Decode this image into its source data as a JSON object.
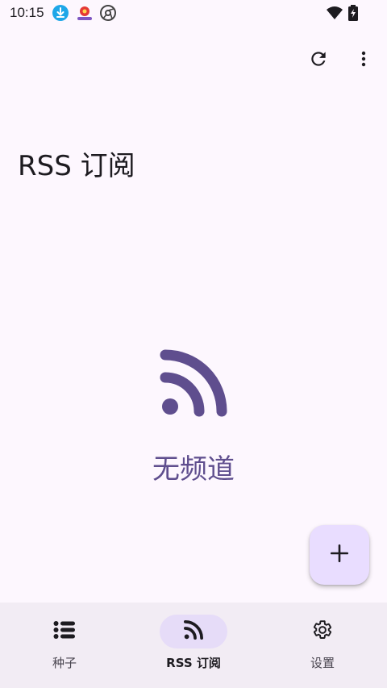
{
  "status_bar": {
    "time": "10:15",
    "icons": [
      "download-icon",
      "app-notification-icon",
      "chrome-like-icon",
      "wifi-icon",
      "battery-charging-icon"
    ]
  },
  "toolbar": {
    "refresh_icon": "refresh-icon",
    "more_icon": "more-vert-icon"
  },
  "page": {
    "title": "RSS 订阅"
  },
  "empty_state": {
    "icon": "rss-feed-icon",
    "message": "无频道"
  },
  "fab": {
    "icon": "add-icon",
    "label": "+"
  },
  "bottom_nav": {
    "items": [
      {
        "label": "种子",
        "icon": "list-icon",
        "active": false
      },
      {
        "label": "RSS 订阅",
        "icon": "rss-icon",
        "active": true
      },
      {
        "label": "设置",
        "icon": "settings-icon",
        "active": false
      }
    ]
  },
  "colors": {
    "background": "#FDF7FE",
    "accent": "#5F4E8E",
    "fab_background": "#E9DDFF",
    "nav_background": "#F2ECF4",
    "nav_active_pill": "#E6DCF8"
  }
}
